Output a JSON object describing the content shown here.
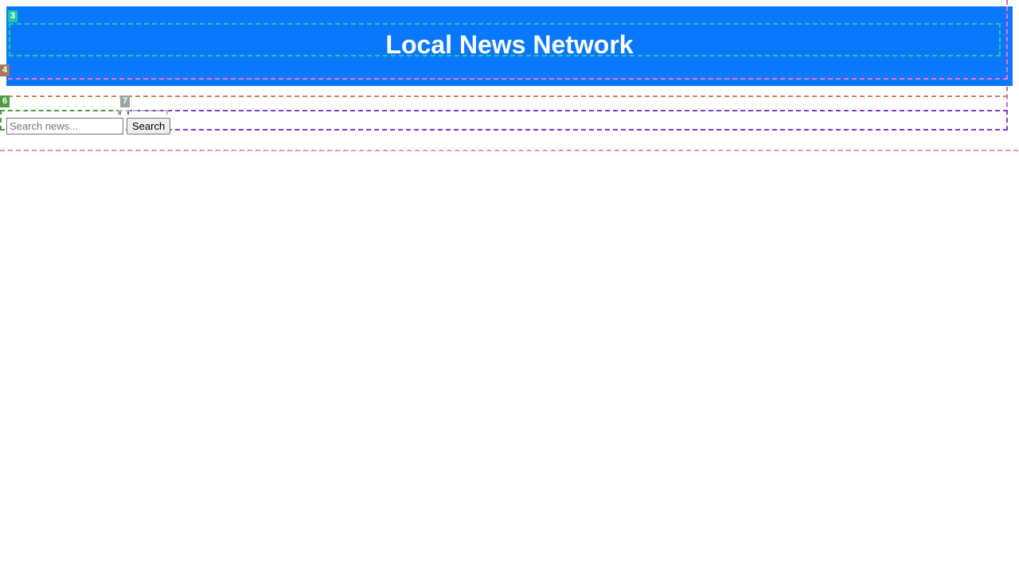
{
  "header": {
    "title": "Local News Network"
  },
  "search": {
    "placeholder": "Search news...",
    "value": "",
    "button_label": "Search"
  },
  "overlay_badges": {
    "header": "3",
    "nav": "4",
    "search_input": "6",
    "search_button": "7"
  },
  "colors": {
    "header_bg": "#0a78fc",
    "header_text": "#ffffff"
  }
}
